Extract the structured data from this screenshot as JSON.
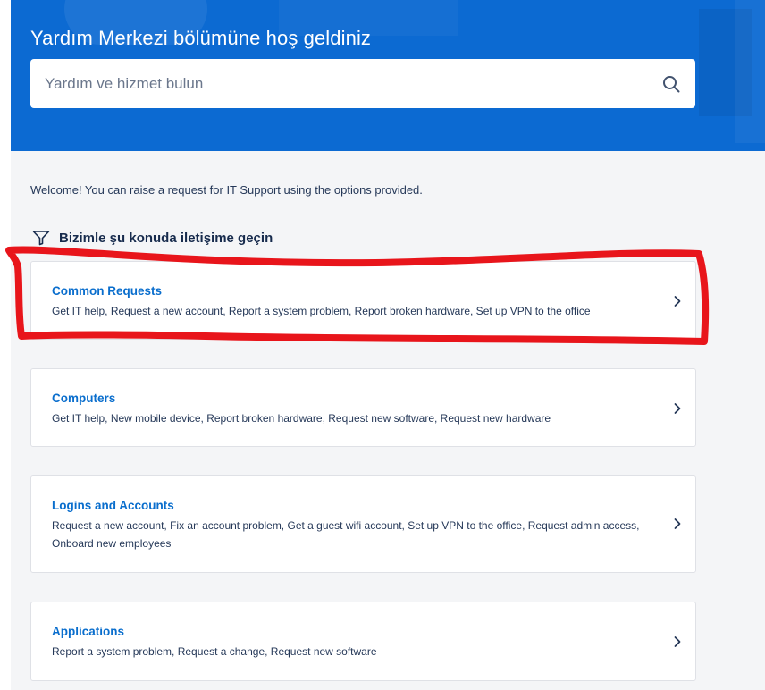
{
  "hero": {
    "title": "Yardım Merkezi bölümüne hoş geldiniz",
    "search_placeholder": "Yardım ve hizmet bulun"
  },
  "welcome_text": "Welcome! You can raise a request for IT Support using the options provided.",
  "section": {
    "title": "Bizimle şu konuda iletişime geçin"
  },
  "cards": [
    {
      "title": "Common Requests",
      "description": "Get IT help, Request a new account, Report a system problem, Report broken hardware, Set up VPN to the office"
    },
    {
      "title": "Computers",
      "description": "Get IT help, New mobile device, Report broken hardware, Request new software, Request new hardware"
    },
    {
      "title": "Logins and Accounts",
      "description": "Request a new account, Fix an account problem, Get a guest wifi account, Set up VPN to the office, Request admin access, Onboard new employees"
    },
    {
      "title": "Applications",
      "description": "Report a system problem, Request a change, Request new software"
    }
  ],
  "colors": {
    "hero_background": "#0c6ad2",
    "card_title": "#0a6ecd",
    "annotation": "#e8151b"
  },
  "icons": {
    "search": "search-icon",
    "filter": "filter-icon",
    "chevron": "chevron-right-icon"
  }
}
